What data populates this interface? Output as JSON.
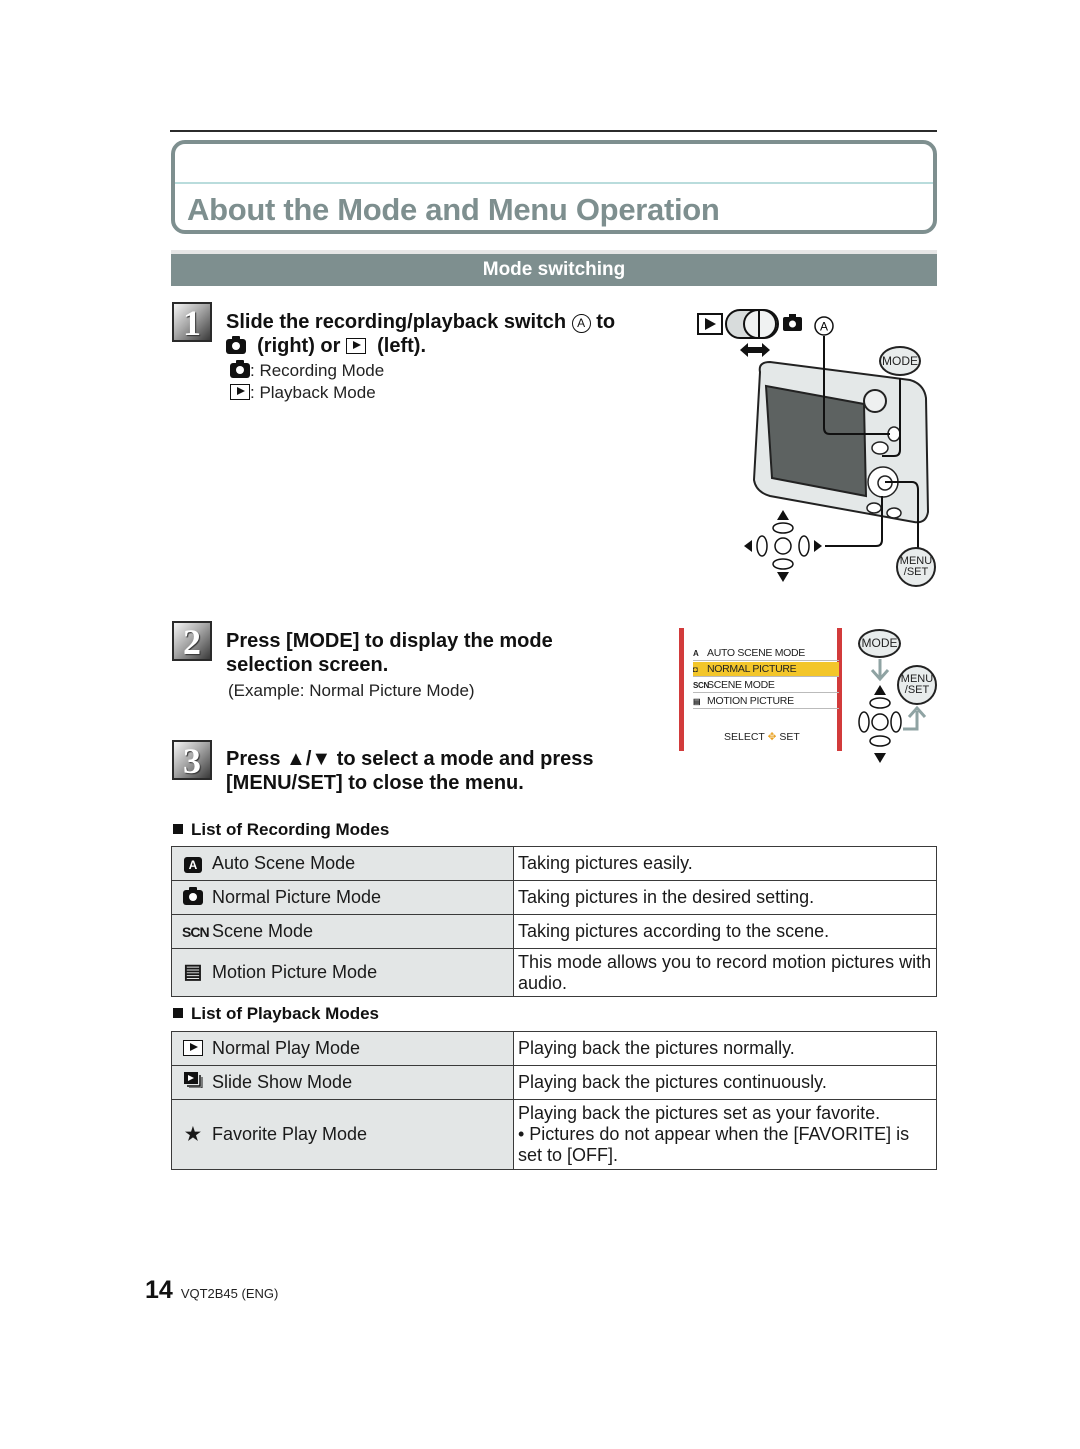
{
  "page": {
    "title": "About the Mode and Menu Operation",
    "section": "Mode switching",
    "page_number": "14",
    "doc_code": "VQT2B45 (ENG)"
  },
  "steps": [
    {
      "number": "1",
      "heading_line1": "Slide the recording/playback switch",
      "marker": "A",
      "heading_to": "to",
      "heading_right": "(right) or",
      "heading_left": "(left).",
      "notes": [
        {
          "icon": "camera-icon",
          "text": ": Recording Mode"
        },
        {
          "icon": "play-icon",
          "text": ": Playback Mode"
        }
      ]
    },
    {
      "number": "2",
      "heading": "Press [MODE] to display the mode selection screen.",
      "heading_line1": "Press [MODE] to display the mode",
      "heading_line2": "selection screen.",
      "note": "(Example: Normal Picture Mode)"
    },
    {
      "number": "3",
      "heading_line1": "Press ▲/▼ to select a mode and press",
      "heading_line2": "[MENU/SET] to close the menu."
    }
  ],
  "camera_figure": {
    "marker": "A",
    "mode_button": "MODE",
    "menu_set_button_line1": "MENU",
    "menu_set_button_line2": "/SET"
  },
  "mode_screen": {
    "items": [
      {
        "icon": "A",
        "label": "AUTO SCENE MODE",
        "selected": false
      },
      {
        "icon": "◘",
        "label": "NORMAL PICTURE",
        "selected": true
      },
      {
        "icon": "SCN",
        "label": "SCENE MODE",
        "selected": false
      },
      {
        "icon": "▤",
        "label": "MOTION PICTURE",
        "selected": false
      }
    ],
    "footer_select": "SELECT",
    "footer_set": "SET",
    "highlight_color": "#f3c62a",
    "border_color": "#d23b3b"
  },
  "recording_modes": {
    "heading": "List of Recording Modes",
    "rows": [
      {
        "icon": "auto-scene-icon",
        "glyph": "A",
        "mode": "Auto Scene Mode",
        "description": "Taking pictures easily."
      },
      {
        "icon": "camera-icon",
        "glyph": "",
        "mode": "Normal Picture Mode",
        "description": "Taking pictures in the desired setting."
      },
      {
        "icon": "scn-icon",
        "glyph": "SCN",
        "mode": "Scene Mode",
        "description": "Taking pictures according to the scene."
      },
      {
        "icon": "film-icon",
        "glyph": "▤",
        "mode": "Motion Picture Mode",
        "description": "This mode allows you to record motion pictures with audio."
      }
    ]
  },
  "playback_modes": {
    "heading": "List of Playback Modes",
    "rows": [
      {
        "icon": "play-icon",
        "glyph": "",
        "mode": "Normal Play Mode",
        "description": "Playing back the pictures normally."
      },
      {
        "icon": "slideshow-icon",
        "glyph": "",
        "mode": "Slide Show Mode",
        "description": "Playing back the pictures continuously."
      },
      {
        "icon": "star-icon",
        "glyph": "★",
        "mode": "Favorite Play Mode",
        "description": "Playing back the pictures set as your favorite.",
        "note": "• Pictures do not appear when the [FAVORITE] is set to [OFF]."
      }
    ]
  }
}
